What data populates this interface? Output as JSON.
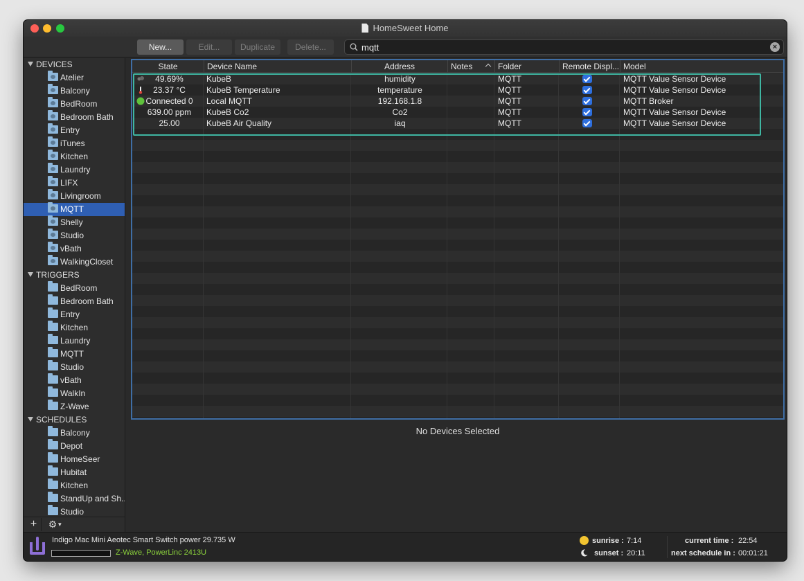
{
  "window": {
    "title": "HomeSweet Home"
  },
  "toolbar": {
    "new_label": "New...",
    "edit_label": "Edit...",
    "duplicate_label": "Duplicate",
    "delete_label": "Delete...",
    "search_value": "mqtt"
  },
  "sidebar": {
    "devices_header": "DEVICES",
    "devices": [
      "Atelier",
      "Balcony",
      "BedRoom",
      "Bedroom Bath",
      "Entry",
      "iTunes",
      "Kitchen",
      "Laundry",
      "LIFX",
      "Livingroom",
      "MQTT",
      "Shelly",
      "Studio",
      "vBath",
      "WalkingCloset"
    ],
    "selected_device_folder": "MQTT",
    "triggers_header": "TRIGGERS",
    "triggers": [
      "BedRoom",
      "Bedroom Bath",
      "Entry",
      "Kitchen",
      "Laundry",
      "MQTT",
      "Studio",
      "vBath",
      "WalkIn",
      "Z-Wave"
    ],
    "schedules_header": "SCHEDULES",
    "schedules": [
      "Balcony",
      "Depot",
      "HomeSeer",
      "Hubitat",
      "Kitchen",
      "StandUp and Sh...",
      "Studio"
    ],
    "add_label": "+",
    "gear_label": "⚙"
  },
  "table": {
    "columns": [
      "State",
      "Device Name",
      "Address",
      "Notes",
      "Folder",
      "Remote Displ...",
      "Model"
    ],
    "sort_column": "Notes",
    "rows": [
      {
        "state_icon": "humidity-icon",
        "state": "49.69%",
        "name": "KubeB",
        "address": "humidity",
        "notes": "",
        "folder": "MQTT",
        "remote_display": true,
        "model": "MQTT Value Sensor Device"
      },
      {
        "state_icon": "thermometer-icon",
        "state": "23.37 °C",
        "name": "KubeB Temperature",
        "address": "temperature",
        "notes": "",
        "folder": "MQTT",
        "remote_display": true,
        "model": "MQTT Value Sensor Device"
      },
      {
        "state_icon": "connected-dot-icon",
        "state": "Connected 0",
        "name": "Local MQTT",
        "address": "192.168.1.8",
        "notes": "",
        "folder": "MQTT",
        "remote_display": true,
        "model": "MQTT Broker"
      },
      {
        "state_icon": "",
        "state": "639.00 ppm",
        "name": "KubeB Co2",
        "address": "Co2",
        "notes": "",
        "folder": "MQTT",
        "remote_display": true,
        "model": "MQTT Value Sensor Device"
      },
      {
        "state_icon": "",
        "state": "25.00",
        "name": "KubeB Air Quality",
        "address": "iaq",
        "notes": "",
        "folder": "MQTT",
        "remote_display": true,
        "model": "MQTT Value Sensor Device"
      }
    ]
  },
  "detail": {
    "empty_text": "No Devices Selected"
  },
  "status": {
    "message": "Indigo Mac Mini Aeotec Smart Switch power 29.735 W",
    "interface_1": "Z-Wave",
    "separator": ",",
    "interface_2": "PowerLinc 2413U",
    "sunrise_label": "sunrise :",
    "sunrise_value": "7:14",
    "sunset_label": "sunset :",
    "sunset_value": "20:11",
    "current_time_label": "current time :",
    "current_time_value": "22:54",
    "next_schedule_label": "next schedule in :",
    "next_schedule_value": "00:01:21"
  },
  "colors": {
    "accent_selection": "#2f5fb3",
    "table_focus": "#3f6ea5",
    "highlight_box": "#3fb6a2",
    "interface_green": "#8cd33c"
  }
}
